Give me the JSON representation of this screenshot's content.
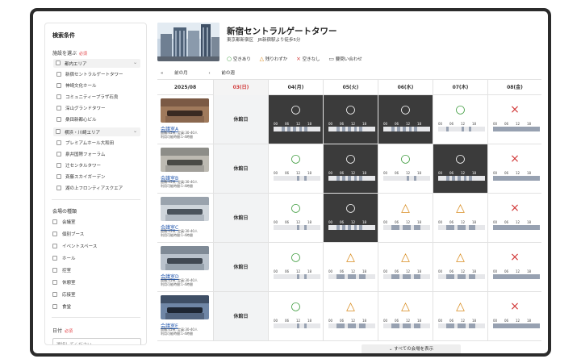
{
  "sidebar": {
    "title": "検索条件",
    "facility_label": "施設を選ぶ",
    "required": "必須",
    "areas": [
      {
        "name": "都内エリア",
        "items": [
          "新宿セントラルゲートタワー",
          "神崎文化ホール",
          "コミュニティープラザ石良",
          "深山グランドタワー",
          "桑田新都心ビル"
        ]
      },
      {
        "name": "横浜・川崎エリア",
        "items": [
          "プレミアムホール大和田",
          "泉井国際フォーラム",
          "辻センタルタワー",
          "斉藤スカイガーデン",
          "湖の上フロンティアスクエア"
        ]
      }
    ],
    "type_label": "会場の種類",
    "types": [
      "会議室",
      "個別ブース",
      "イベントスペース",
      "ホール",
      "控室",
      "休憩室",
      "応接室",
      "食堂"
    ],
    "date_label": "日付",
    "date_placeholder": "選択してください"
  },
  "header": {
    "title": "新宿セントラルゲートタワー",
    "subtitle": "東京都新宿区　JR新宿駅より徒歩5分",
    "legend": [
      {
        "icon": "circle-icon",
        "symbol": "○",
        "label": "空きあり"
      },
      {
        "icon": "triangle-icon",
        "symbol": "△",
        "label": "残りわずか"
      },
      {
        "icon": "cross-icon",
        "symbol": "×",
        "label": "空きなし"
      },
      {
        "icon": "chat-icon",
        "symbol": "▭",
        "label": "要問い合わせ"
      }
    ]
  },
  "week_nav": {
    "prev_month": "前の月",
    "prev_week": "前の週"
  },
  "table": {
    "month": "2025/08",
    "days": [
      {
        "label": "03(日)",
        "sunday": true
      },
      {
        "label": "04(月)"
      },
      {
        "label": "05(火)"
      },
      {
        "label": "06(水)"
      },
      {
        "label": "07(木)"
      },
      {
        "label": "08(金)"
      }
    ],
    "closed_label": "休館日",
    "hour_ticks": [
      "00",
      "06",
      "12",
      "18"
    ],
    "rooms": [
      {
        "name": "会議室A",
        "info1": "面積:45㎡, 定員:30-40人",
        "info2": "利用可能時間:1-4時間",
        "days": [
          {
            "status": "open",
            "dark": true,
            "bar": [
              [
                0.18,
                0.24
              ],
              [
                0.3,
                0.36
              ],
              [
                0.42,
                0.48
              ],
              [
                0.55,
                0.6
              ],
              [
                0.66,
                0.72
              ]
            ]
          },
          {
            "status": "open",
            "dark": true,
            "bar": [
              [
                0.18,
                0.24
              ],
              [
                0.3,
                0.36
              ],
              [
                0.42,
                0.48
              ],
              [
                0.55,
                0.6
              ],
              [
                0.66,
                0.72
              ]
            ]
          },
          {
            "status": "open",
            "dark": true,
            "bar": [
              [
                0.18,
                0.24
              ],
              [
                0.3,
                0.36
              ],
              [
                0.42,
                0.48
              ],
              [
                0.55,
                0.6
              ],
              [
                0.66,
                0.72
              ]
            ]
          },
          {
            "status": "open",
            "dark": false,
            "bar": [
              [
                0.18,
                0.22
              ],
              [
                0.5,
                0.55
              ],
              [
                0.66,
                0.7
              ]
            ]
          },
          {
            "status": "none",
            "dark": false,
            "bar": [
              [
                0,
                1
              ]
            ]
          }
        ]
      },
      {
        "name": "会議室B",
        "info1": "面積:45㎡, 定員:30-40人",
        "info2": "利用可能時間:1-4時間",
        "days": [
          {
            "status": "open",
            "dark": false,
            "bar": [
              [
                0.5,
                0.55
              ],
              [
                0.66,
                0.7
              ]
            ]
          },
          {
            "status": "open",
            "dark": true,
            "bar": [
              [
                0.18,
                0.24
              ],
              [
                0.3,
                0.36
              ],
              [
                0.42,
                0.48
              ],
              [
                0.55,
                0.6
              ],
              [
                0.66,
                0.72
              ]
            ]
          },
          {
            "status": "open",
            "dark": false,
            "bar": [
              [
                0.5,
                0.55
              ],
              [
                0.66,
                0.7
              ]
            ]
          },
          {
            "status": "open",
            "dark": true,
            "bar": [
              [
                0.18,
                0.24
              ],
              [
                0.3,
                0.36
              ],
              [
                0.42,
                0.48
              ],
              [
                0.55,
                0.6
              ],
              [
                0.66,
                0.72
              ]
            ]
          },
          {
            "status": "none",
            "dark": false,
            "bar": [
              [
                0,
                1
              ]
            ]
          }
        ]
      },
      {
        "name": "会議室C",
        "info1": "面積:45㎡, 定員:30-40人",
        "info2": "利用可能時間:1-4時間",
        "days": [
          {
            "status": "open",
            "dark": false,
            "bar": [
              [
                0.5,
                0.55
              ],
              [
                0.66,
                0.7
              ]
            ]
          },
          {
            "status": "open",
            "dark": true,
            "bar": [
              [
                0.18,
                0.24
              ],
              [
                0.3,
                0.36
              ],
              [
                0.42,
                0.48
              ],
              [
                0.55,
                0.6
              ],
              [
                0.66,
                0.72
              ]
            ]
          },
          {
            "status": "few",
            "dark": false,
            "bar": [
              [
                0.18,
                0.35
              ],
              [
                0.42,
                0.58
              ],
              [
                0.66,
                0.8
              ]
            ]
          },
          {
            "status": "few",
            "dark": false,
            "bar": [
              [
                0.18,
                0.35
              ],
              [
                0.42,
                0.58
              ],
              [
                0.66,
                0.8
              ]
            ]
          },
          {
            "status": "none",
            "dark": false,
            "bar": [
              [
                0,
                1
              ]
            ]
          }
        ]
      },
      {
        "name": "会議室D",
        "info1": "面積:45㎡, 定員:30-40人",
        "info2": "利用可能時間:1-4時間",
        "days": [
          {
            "status": "open",
            "dark": false,
            "bar": [
              [
                0.5,
                0.55
              ],
              [
                0.66,
                0.7
              ]
            ]
          },
          {
            "status": "few",
            "dark": false,
            "bar": [
              [
                0.18,
                0.35
              ],
              [
                0.42,
                0.58
              ],
              [
                0.66,
                0.8
              ]
            ]
          },
          {
            "status": "few",
            "dark": false,
            "bar": [
              [
                0.18,
                0.35
              ],
              [
                0.42,
                0.58
              ],
              [
                0.66,
                0.8
              ]
            ]
          },
          {
            "status": "few",
            "dark": false,
            "bar": [
              [
                0.18,
                0.35
              ],
              [
                0.42,
                0.58
              ],
              [
                0.66,
                0.8
              ]
            ]
          },
          {
            "status": "none",
            "dark": false,
            "bar": [
              [
                0,
                1
              ]
            ]
          }
        ]
      },
      {
        "name": "会議室E",
        "info1": "面積:45㎡, 定員:30-40人",
        "info2": "利用可能時間:1-4時間",
        "days": [
          {
            "status": "open",
            "dark": false,
            "bar": [
              [
                0.5,
                0.55
              ],
              [
                0.66,
                0.7
              ]
            ]
          },
          {
            "status": "few",
            "dark": false,
            "bar": [
              [
                0.18,
                0.35
              ],
              [
                0.42,
                0.58
              ],
              [
                0.66,
                0.8
              ]
            ]
          },
          {
            "status": "few",
            "dark": false,
            "bar": [
              [
                0.18,
                0.35
              ],
              [
                0.42,
                0.58
              ],
              [
                0.66,
                0.8
              ]
            ]
          },
          {
            "status": "few",
            "dark": false,
            "bar": [
              [
                0.18,
                0.35
              ],
              [
                0.42,
                0.58
              ],
              [
                0.66,
                0.8
              ]
            ]
          },
          {
            "status": "none",
            "dark": false,
            "bar": [
              [
                0,
                1
              ]
            ]
          }
        ]
      }
    ]
  },
  "show_all": "すべての会場を表示",
  "colors": {
    "open": "#3a9a3a",
    "few": "#d88a1c",
    "none": "#d23a3a",
    "dark_cell": "#3b3b3b",
    "link": "#2a5db0",
    "required": "#e0393e"
  }
}
